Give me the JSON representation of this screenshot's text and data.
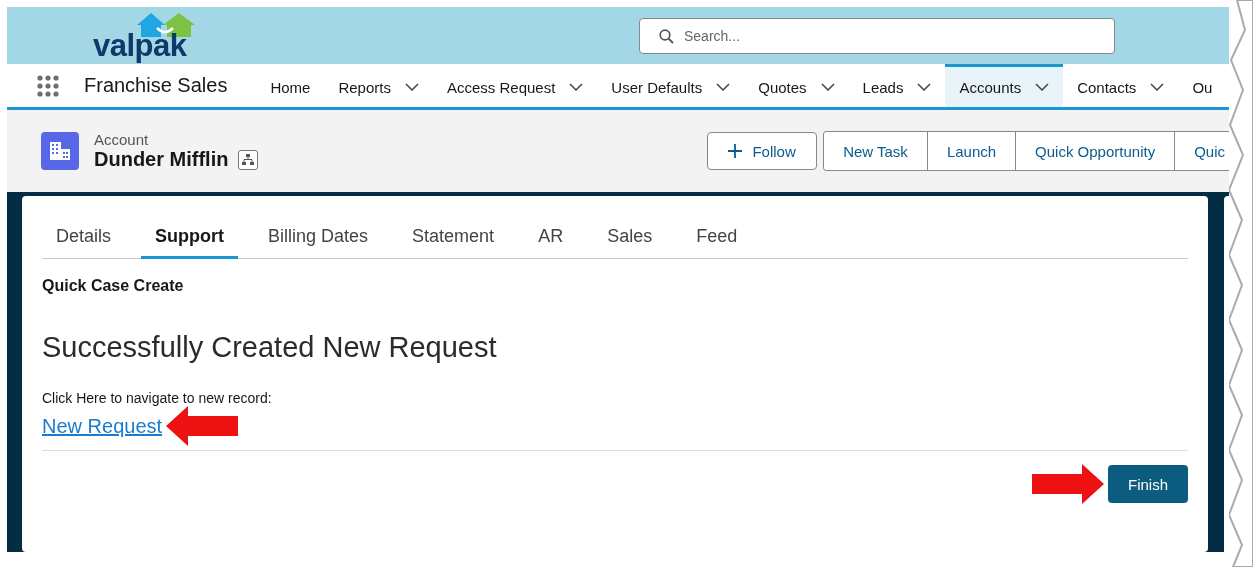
{
  "header": {
    "logo": "valpak",
    "search": {
      "placeholder": "Search..."
    }
  },
  "nav": {
    "app_name": "Franchise Sales",
    "items": [
      {
        "label": "Home",
        "has_menu": false,
        "selected": false
      },
      {
        "label": "Reports",
        "has_menu": true,
        "selected": false
      },
      {
        "label": "Access Request",
        "has_menu": true,
        "selected": false
      },
      {
        "label": "User Defaults",
        "has_menu": true,
        "selected": false
      },
      {
        "label": "Quotes",
        "has_menu": true,
        "selected": false
      },
      {
        "label": "Leads",
        "has_menu": true,
        "selected": false
      },
      {
        "label": "Accounts",
        "has_menu": true,
        "selected": true
      },
      {
        "label": "Contacts",
        "has_menu": true,
        "selected": false
      },
      {
        "label": "Ou",
        "has_menu": false,
        "selected": false
      }
    ]
  },
  "record": {
    "type": "Account",
    "name": "Dunder Mifflin",
    "follow": "Follow",
    "actions": [
      "New Task",
      "Launch",
      "Quick Opportunity",
      "Quic"
    ]
  },
  "tabs": [
    {
      "label": "Details",
      "selected": false
    },
    {
      "label": "Support",
      "selected": true
    },
    {
      "label": "Billing Dates",
      "selected": false
    },
    {
      "label": "Statement",
      "selected": false
    },
    {
      "label": "AR",
      "selected": false
    },
    {
      "label": "Sales",
      "selected": false
    },
    {
      "label": "Feed",
      "selected": false
    }
  ],
  "flow": {
    "title": "Quick Case Create",
    "heading": "Successfully Created New Request",
    "prompt": "Click Here to navigate to new record:",
    "link": "New Request",
    "finish": "Finish"
  },
  "annotations": [
    {
      "kind": "arrow"
    },
    {
      "kind": "arrow"
    }
  ]
}
